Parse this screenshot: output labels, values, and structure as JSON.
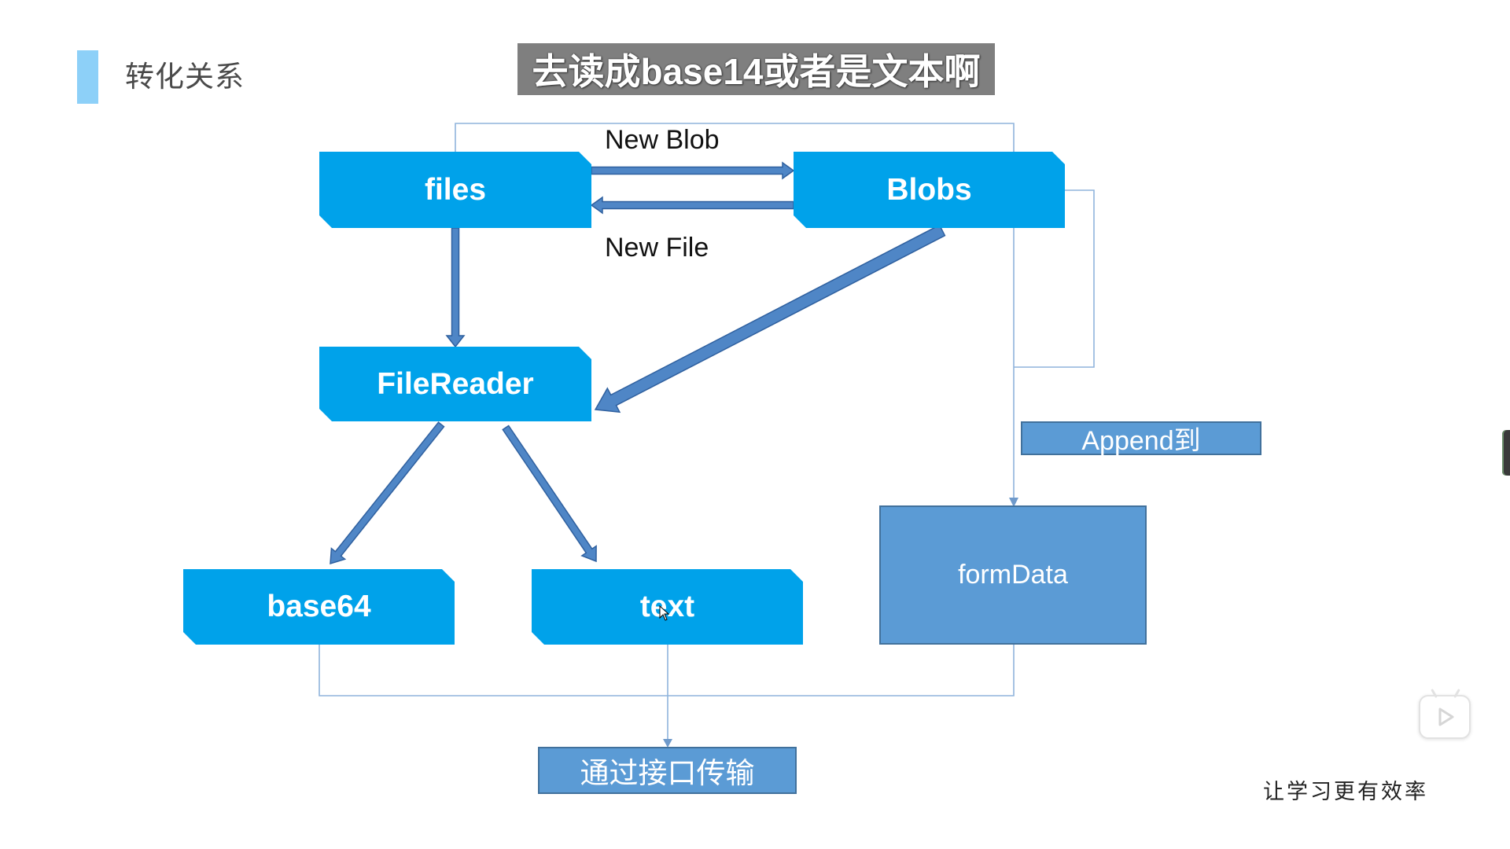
{
  "slide": {
    "title": "转化关系",
    "caption": "去读成base14或者是文本啊",
    "watermark": "让学习更有效率"
  },
  "nodes": {
    "files": "files",
    "blobs": "Blobs",
    "filereader": "FileReader",
    "base64": "base64",
    "text": "text",
    "formdata": "formData",
    "append": "Append到",
    "transfer": "通过接口传输"
  },
  "edge_labels": {
    "new_blob": "New Blob",
    "new_file": "New File"
  },
  "colors": {
    "accent": "#8dd0f8",
    "node": "#00a2ea",
    "secondary": "#5b9bd5",
    "secondary_border": "#41719c",
    "arrow": "#4f86c6",
    "line": "#8fb4dc"
  },
  "icons": {
    "play": "play-icon",
    "cursor": "mouse-cursor-icon"
  }
}
